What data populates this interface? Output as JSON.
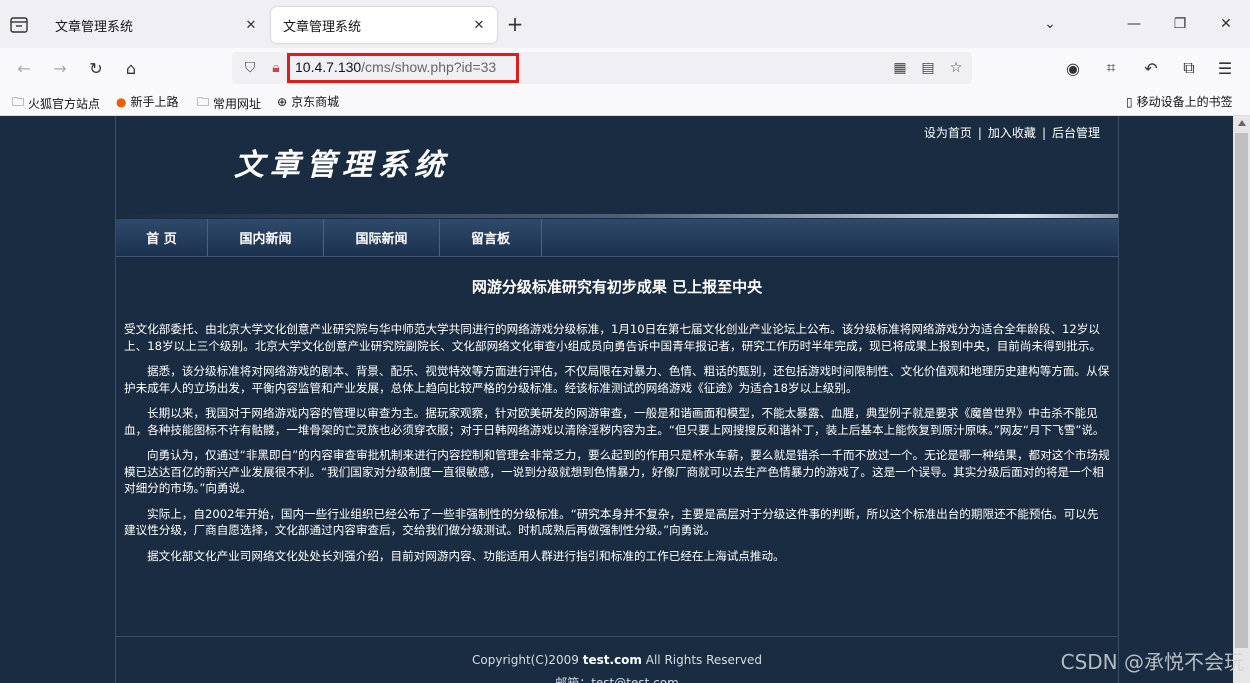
{
  "browser": {
    "tabs": [
      {
        "title": "文章管理系统",
        "active": false
      },
      {
        "title": "文章管理系统",
        "active": true
      }
    ],
    "url": {
      "host": "10.4.7.130",
      "path": "/cms/show.php?id=33"
    },
    "bookmarks": [
      {
        "label": "火狐官方站点",
        "icon": "folder-icon"
      },
      {
        "label": "新手上路",
        "icon": "firefox-icon"
      },
      {
        "label": "常用网址",
        "icon": "folder-icon"
      },
      {
        "label": "京东商城",
        "icon": "globe-icon"
      }
    ],
    "mobile_bookmarks": "移动设备上的书签"
  },
  "site": {
    "toplinks": {
      "home": "设为首页",
      "sep": "|",
      "fav": "加入收藏",
      "admin": "后台管理"
    },
    "logo": "文章管理系统",
    "menu": [
      "首 页",
      "国内新闻",
      "国际新闻",
      "留言板"
    ],
    "article": {
      "title": "网游分级标准研究有初步成果 已上报至中央",
      "paragraphs": [
        "受文化部委托、由北京大学文化创意产业研究院与华中师范大学共同进行的网络游戏分级标准，1月10日在第七届文化创业产业论坛上公布。该分级标准将网络游戏分为适合全年龄段、12岁以上、18岁以上三个级别。北京大学文化创意产业研究院副院长、文化部网络文化审查小组成员向勇告诉中国青年报记者，研究工作历时半年完成，现已将成果上报到中央，目前尚未得到批示。",
        "据悉，该分级标准将对网络游戏的剧本、背景、配乐、视觉特效等方面进行评估，不仅局限在对暴力、色情、粗话的甄别，还包括游戏时间限制性、文化价值观和地理历史建构等方面。从保护未成年人的立场出发，平衡内容监管和产业发展，总体上趋向比较严格的分级标准。经该标准测试的网络游戏《征途》为适合18岁以上级别。",
        "长期以来，我国对于网络游戏内容的管理以审查为主。据玩家观察，针对欧美研发的网游审查，一般是和谐画面和模型，不能太暴露、血腥，典型例子就是要求《魔兽世界》中击杀不能见血，各种技能图标不许有骷髅，一堆骨架的亡灵族也必须穿衣服；对于日韩网络游戏以清除淫秽内容为主。“但只要上网搜搜反和谐补丁，装上后基本上能恢复到原汁原味。”网友“月下飞雪”说。",
        "向勇认为，仅通过“非黑即白”的内容审查审批机制来进行内容控制和管理会非常乏力，要么起到的作用只是杯水车薪，要么就是错杀一千而不放过一个。无论是哪一种结果，都对这个市场规模已达达百亿的新兴产业发展很不利。“我们国家对分级制度一直很敏感，一说到分级就想到色情暴力，好像厂商就可以去生产色情暴力的游戏了。这是一个误导。其实分级后面对的将是一个相对细分的市场。”向勇说。",
        "实际上，自2002年开始，国内一些行业组织已经公布了一些非强制性的分级标准。“研究本身并不复杂，主要是高层对于分级这件事的判断，所以这个标准出台的期限还不能预估。可以先建议性分级，厂商自愿选择，文化部通过内容审查后，交给我们做分级测试。时机成熟后再做强制性分级。”向勇说。",
        "据文化部文化产业司网络文化处处长刘强介绍，目前对网游内容、功能适用人群进行指引和标准的工作已经在上海试点推动。"
      ]
    },
    "footer": {
      "prefix": "Copyright(C)2009 ",
      "domain": "test.com",
      "suffix": " All Rights Reserved",
      "line2": "邮箱：test@test.com"
    }
  },
  "watermark": "CSDN @承悦不会玩"
}
